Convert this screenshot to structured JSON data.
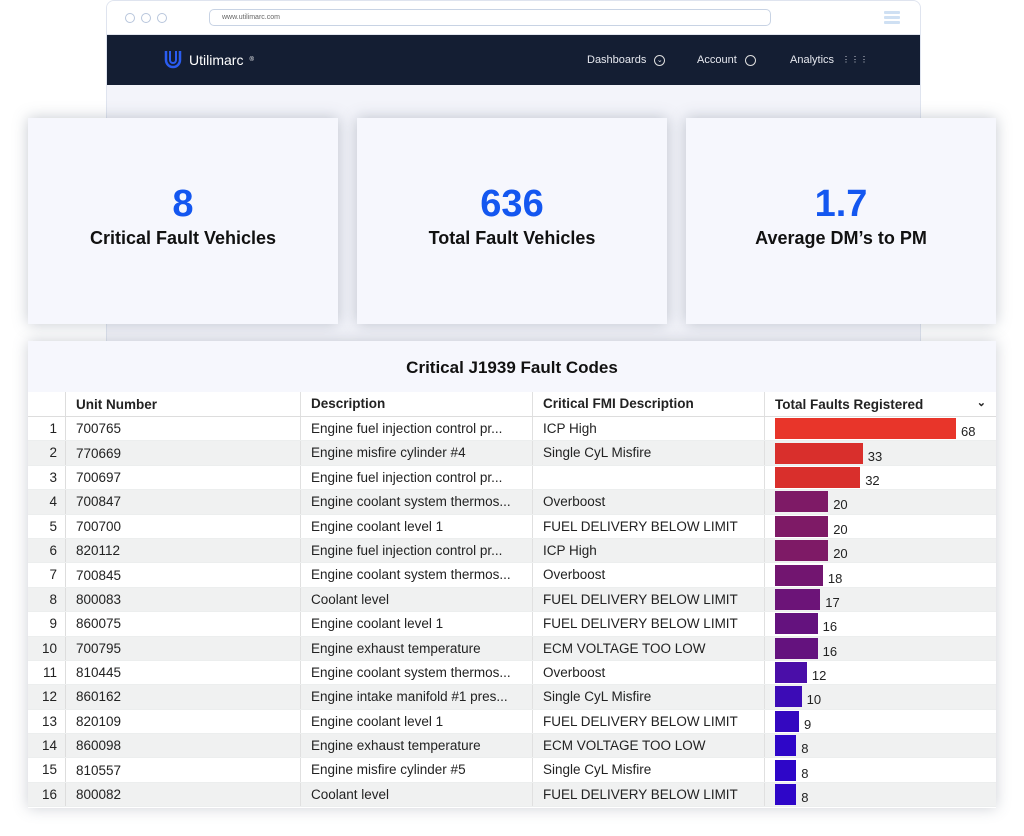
{
  "browser": {
    "url": "www.utilimarc.com"
  },
  "nav": {
    "brand": "Utilimarc",
    "brand_mark": "®",
    "items": [
      {
        "label": "Dashboards",
        "icon": "chevron-circle-icon"
      },
      {
        "label": "Account",
        "icon": "user-circle-icon"
      },
      {
        "label": "Analytics",
        "icon": "grid-icon"
      }
    ]
  },
  "cards": [
    {
      "value": "8",
      "label": "Critical Fault Vehicles"
    },
    {
      "value": "636",
      "label": "Total Fault Vehicles"
    },
    {
      "value": "1.7",
      "label": "Average DM’s to PM"
    }
  ],
  "colors": {
    "accent": "#1457f0",
    "nav_bg": "#141e33"
  },
  "table": {
    "title": "Critical J1939 Fault Codes",
    "columns": [
      "Unit Number",
      "Description",
      "Critical FMI Description",
      "Total Faults Registered"
    ],
    "max": 68,
    "rows": [
      {
        "n": "1",
        "unit": "700765",
        "desc": "Engine fuel injection control pr...",
        "fmi": "ICP High",
        "total": 68,
        "color": "#e8352a"
      },
      {
        "n": "2",
        "unit": "770669",
        "desc": "Engine misfire cylinder #4",
        "fmi": "Single CyL Misfire",
        "total": 33,
        "color": "#d92f2c"
      },
      {
        "n": "3",
        "unit": "700697",
        "desc": "Engine fuel injection control pr...",
        "fmi": "",
        "total": 32,
        "color": "#d92f2c"
      },
      {
        "n": "4",
        "unit": "700847",
        "desc": "Engine coolant system thermos...",
        "fmi": "Overboost",
        "total": 20,
        "color": "#7e1a66"
      },
      {
        "n": "5",
        "unit": "700700",
        "desc": "Engine coolant level 1",
        "fmi": "FUEL DELIVERY BELOW LIMIT",
        "total": 20,
        "color": "#7e1a66"
      },
      {
        "n": "6",
        "unit": "820112",
        "desc": "Engine fuel injection control pr...",
        "fmi": "ICP High",
        "total": 20,
        "color": "#7e1a66"
      },
      {
        "n": "7",
        "unit": "700845",
        "desc": "Engine coolant system thermos...",
        "fmi": "Overboost",
        "total": 18,
        "color": "#721570"
      },
      {
        "n": "8",
        "unit": "800083",
        "desc": "Coolant level",
        "fmi": "FUEL DELIVERY BELOW LIMIT",
        "total": 17,
        "color": "#6c1478"
      },
      {
        "n": "9",
        "unit": "860075",
        "desc": "Engine coolant level 1",
        "fmi": "FUEL DELIVERY BELOW LIMIT",
        "total": 16,
        "color": "#64127e"
      },
      {
        "n": "10",
        "unit": "700795",
        "desc": "Engine exhaust temperature",
        "fmi": "ECM VOLTAGE TOO LOW",
        "total": 16,
        "color": "#64127e"
      },
      {
        "n": "11",
        "unit": "810445",
        "desc": "Engine coolant system thermos...",
        "fmi": "Overboost",
        "total": 12,
        "color": "#4a0ea8"
      },
      {
        "n": "12",
        "unit": "860162",
        "desc": "Engine intake manifold #1 pres...",
        "fmi": "Single CyL Misfire",
        "total": 10,
        "color": "#3c0bb6"
      },
      {
        "n": "13",
        "unit": "820109",
        "desc": "Engine coolant level 1",
        "fmi": "FUEL DELIVERY BELOW LIMIT",
        "total": 9,
        "color": "#3408c0"
      },
      {
        "n": "14",
        "unit": "860098",
        "desc": "Engine exhaust temperature",
        "fmi": "ECM VOLTAGE TOO LOW",
        "total": 8,
        "color": "#2e06c8"
      },
      {
        "n": "15",
        "unit": "810557",
        "desc": "Engine misfire cylinder #5",
        "fmi": "Single CyL Misfire",
        "total": 8,
        "color": "#2e06c8"
      },
      {
        "n": "16",
        "unit": "800082",
        "desc": "Coolant level",
        "fmi": "FUEL DELIVERY BELOW LIMIT",
        "total": 8,
        "color": "#2e06c8"
      }
    ]
  }
}
